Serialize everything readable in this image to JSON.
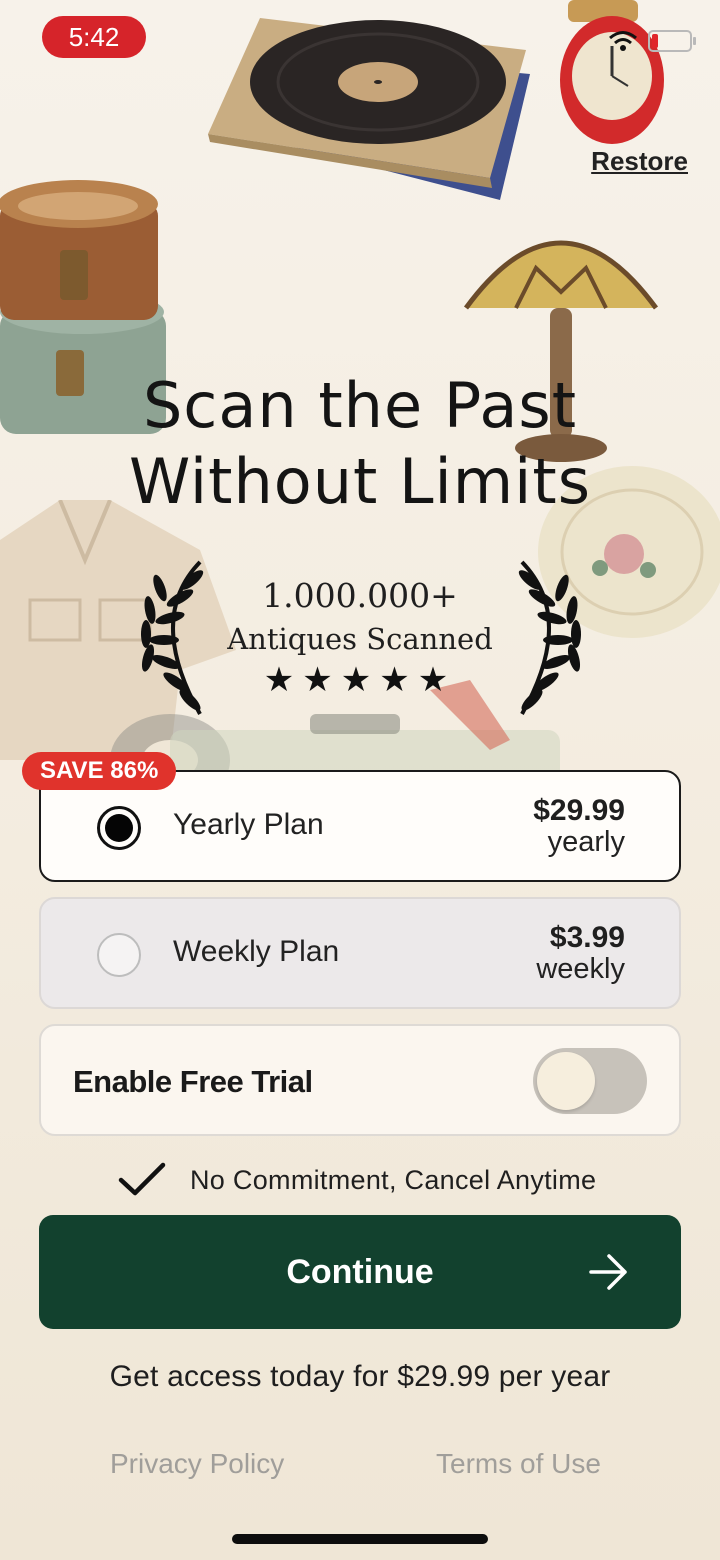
{
  "status_bar": {
    "time": "5:42"
  },
  "header": {
    "restore_label": "Restore"
  },
  "hero": {
    "title_line1": "Scan the Past",
    "title_line2": "Without Limits",
    "count": "1.000.000+",
    "count_label": "Antiques Scanned",
    "stars": "★★★★★"
  },
  "plans": [
    {
      "badge": "SAVE 86%",
      "name": "Yearly Plan",
      "price": "$29.99",
      "period": "yearly",
      "selected": true
    },
    {
      "name": "Weekly Plan",
      "price": "$3.99",
      "period": "weekly",
      "selected": false
    }
  ],
  "trial": {
    "label": "Enable Free Trial",
    "enabled": false
  },
  "commitment_text": "No Commitment, Cancel Anytime",
  "cta": {
    "label": "Continue"
  },
  "access_text": "Get access today for $29.99 per year",
  "footer": {
    "privacy": "Privacy Policy",
    "terms": "Terms of Use"
  },
  "colors": {
    "accent": "#12412e",
    "badge": "#e0332c",
    "time_pill": "#d6242a",
    "background": "#f3ece0"
  },
  "icons": [
    "wifi-icon",
    "battery-icon",
    "checkmark-icon",
    "arrow-right-icon",
    "laurel-left-icon",
    "laurel-right-icon"
  ]
}
